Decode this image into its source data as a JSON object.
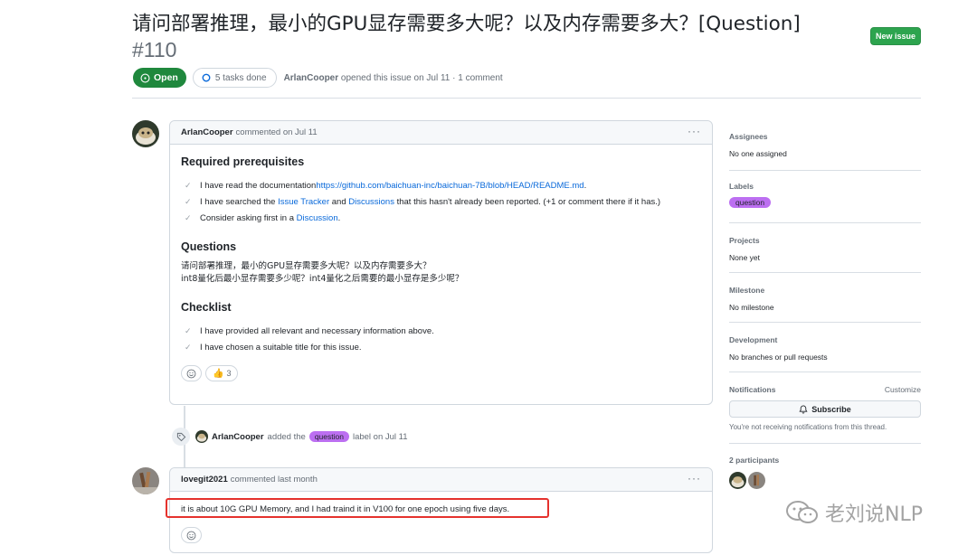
{
  "issue": {
    "title": "请问部署推理，最小的GPU显存需要多大呢？以及内存需要多大？[Question]",
    "number": "#110",
    "state": "Open",
    "tasks": "5 tasks done",
    "author": "ArlanCooper",
    "opened_text": "opened this issue on Jul 11 · 1 comment"
  },
  "header": {
    "new_issue_label": "New issue"
  },
  "comment1": {
    "author": "ArlanCooper",
    "meta": "commented on Jul 11",
    "sections": {
      "prereq_title": "Required prerequisites",
      "prereq": {
        "t1_pre": "I have read the documentation ",
        "t1_link": "https://github.com/baichuan-inc/baichuan-7B/blob/HEAD/README.md",
        "t1_post": ".",
        "t2_pre": "I have searched the ",
        "t2_link1": "Issue Tracker",
        "t2_mid": " and ",
        "t2_link2": "Discussions",
        "t2_post": " that this hasn't already been reported. (+1 or comment there if it has.)",
        "t3_pre": "Consider asking first in a ",
        "t3_link": "Discussion",
        "t3_post": "."
      },
      "questions_title": "Questions",
      "questions_line1": "请问部署推理，最小的GPU显存需要多大呢？以及内存需要多大？",
      "questions_line2": "int8量化后最小显存需要多少呢？int4量化之后需要的最小显存是多少呢？",
      "checklist_title": "Checklist",
      "check1": "I have provided all relevant and necessary information above.",
      "check2": "I have chosen a suitable title for this issue."
    },
    "thumbs_count": "3"
  },
  "event": {
    "actor": "ArlanCooper",
    "pre": "added the",
    "label": "question",
    "post": "label on Jul 11"
  },
  "comment2": {
    "author": "lovegit2021",
    "meta": "commented last month",
    "body": "it is about 10G GPU Memory, and I had traind it in V100 for one epoch using five days."
  },
  "sidebar": {
    "assignees_title": "Assignees",
    "assignees_value": "No one assigned",
    "labels_title": "Labels",
    "labels_value": "question",
    "projects_title": "Projects",
    "projects_value": "None yet",
    "milestone_title": "Milestone",
    "milestone_value": "No milestone",
    "development_title": "Development",
    "development_value": "No branches or pull requests",
    "notifications_title": "Notifications",
    "customize": "Customize",
    "subscribe": "Subscribe",
    "notify_note": "You're not receiving notifications from this thread.",
    "participants_title": "2 participants"
  },
  "watermark": "老刘说NLP",
  "colors": {
    "open": "#1f883d",
    "new_issue": "#2da44e",
    "label": "#bc6ff1",
    "link": "#0969da",
    "highlight": "#e5322d"
  }
}
